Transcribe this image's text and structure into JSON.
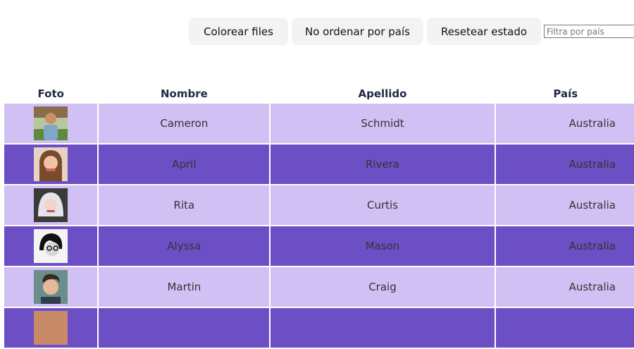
{
  "toolbar": {
    "color_rows_label": "Colorear files",
    "no_sort_label": "No ordenar por país",
    "reset_label": "Resetear estado",
    "filter_placeholder": "Filtra por país"
  },
  "table": {
    "headers": {
      "photo": "Foto",
      "first_name": "Nombre",
      "last_name": "Apellido",
      "country": "País"
    },
    "rows": [
      {
        "first_name": "Cameron",
        "last_name": "Schmidt",
        "country": "Australia",
        "photo": "user-photo-cameron"
      },
      {
        "first_name": "April",
        "last_name": "Rivera",
        "country": "Australia",
        "photo": "user-photo-april"
      },
      {
        "first_name": "Rita",
        "last_name": "Curtis",
        "country": "Australia",
        "photo": "user-photo-rita"
      },
      {
        "first_name": "Alyssa",
        "last_name": "Mason",
        "country": "Australia",
        "photo": "user-photo-alyssa"
      },
      {
        "first_name": "Martin",
        "last_name": "Craig",
        "country": "Australia",
        "photo": "user-photo-martin"
      }
    ]
  },
  "colors": {
    "row_light": "#d1c0f3",
    "row_dark": "#6c4fc5",
    "header_text": "#1f2a44"
  }
}
